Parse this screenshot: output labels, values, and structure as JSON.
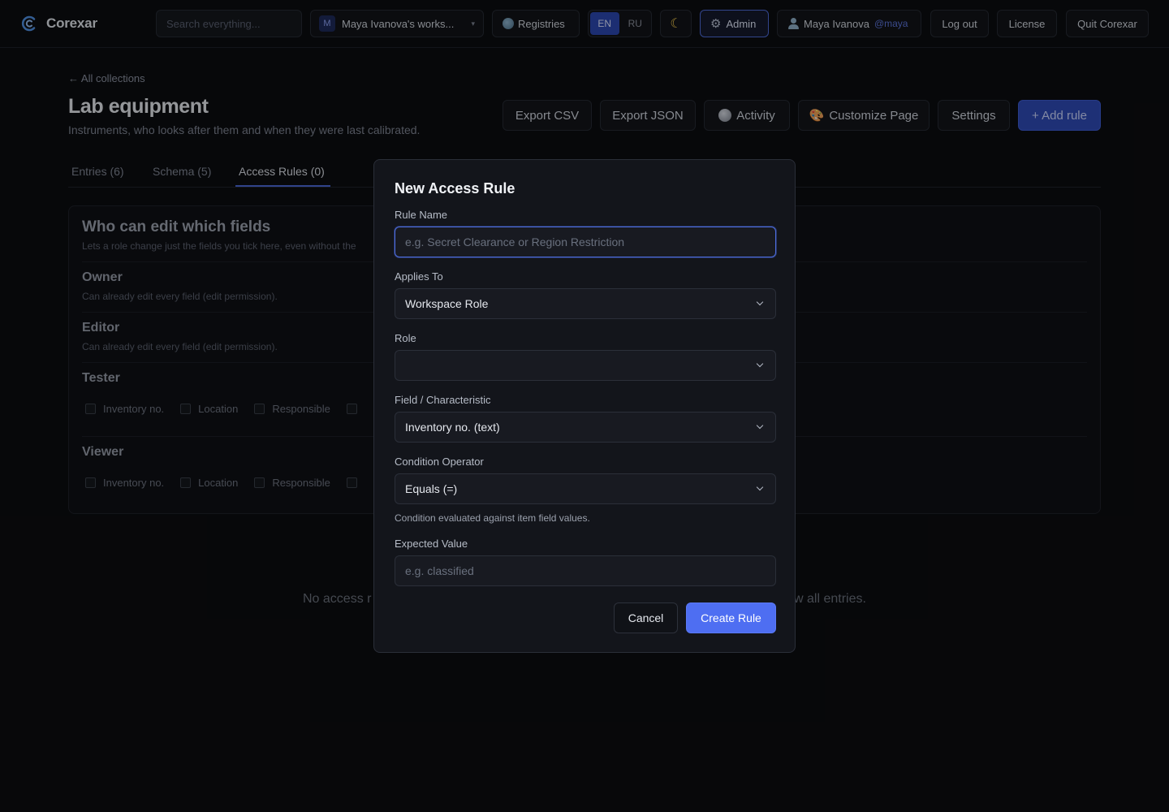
{
  "app": {
    "name": "Corexar"
  },
  "topbar": {
    "search_placeholder": "Search everything...",
    "workspace_initial": "M",
    "workspace_label": "Maya Ivanova's works...",
    "registries_label": "Registries",
    "lang_en": "EN",
    "lang_ru": "RU",
    "active_lang": "EN",
    "admin_label": "Admin",
    "user_name": "Maya Ivanova",
    "user_handle": "@maya",
    "logout_label": "Log out",
    "license_label": "License",
    "quit_label": "Quit Corexar"
  },
  "page": {
    "back_label": "← All collections",
    "title": "Lab equipment",
    "subtitle": "Instruments, who looks after them and when they were last calibrated.",
    "actions": {
      "export_csv": "Export CSV",
      "export_json": "Export JSON",
      "activity": "Activity",
      "customize": "Customize Page",
      "settings": "Settings",
      "add_rule": "+ Add rule"
    },
    "tabs": [
      {
        "label": "Entries (6)"
      },
      {
        "label": "Schema (5)"
      },
      {
        "label": "Access Rules (0)",
        "active": true
      }
    ]
  },
  "field_edit": {
    "title": "Who can edit which fields",
    "subtitle": "Lets a role change just the fields you tick here, even without the",
    "roles": [
      {
        "name": "Owner",
        "note": "Can already edit every field (edit permission)."
      },
      {
        "name": "Editor",
        "note": "Can already edit every field (edit permission)."
      },
      {
        "name": "Tester",
        "fields": [
          "Inventory no.",
          "Location",
          "Responsible"
        ]
      },
      {
        "name": "Viewer",
        "fields": [
          "Inventory no.",
          "Location",
          "Responsible"
        ]
      }
    ],
    "empty_left": "No access r",
    "empty_right": "w all entries."
  },
  "modal": {
    "title": "New Access Rule",
    "rule_name_label": "Rule Name",
    "rule_name_placeholder": "e.g. Secret Clearance or Region Restriction",
    "applies_to_label": "Applies To",
    "applies_to_value": "Workspace Role",
    "role_label": "Role",
    "role_value": "",
    "field_label": "Field / Characteristic",
    "field_value": "Inventory no. (text)",
    "operator_label": "Condition Operator",
    "operator_value": "Equals (=)",
    "hint": "Condition evaluated against item field values.",
    "expected_label": "Expected Value",
    "expected_placeholder": "e.g. classified",
    "cancel_label": "Cancel",
    "create_label": "Create Rule"
  },
  "colors": {
    "accent": "#4e6ef2",
    "background": "#0c0d10",
    "modal_bg": "#13151b"
  }
}
